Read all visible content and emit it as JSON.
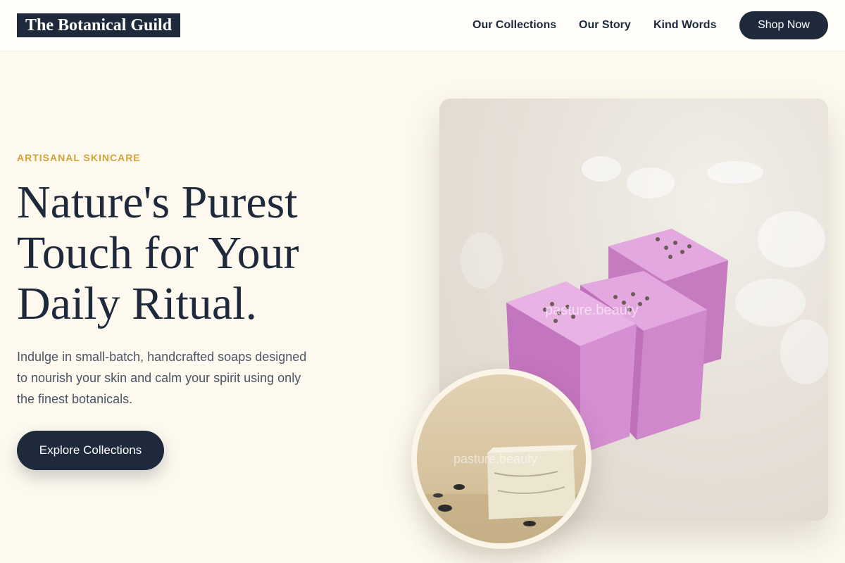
{
  "header": {
    "brand": "The Botanical Guild",
    "nav": {
      "collections": "Our Collections",
      "story": "Our Story",
      "kind_words": "Kind Words"
    },
    "cta": "Shop Now"
  },
  "hero": {
    "eyebrow": "ARTISANAL SKINCARE",
    "headline": [
      "Nature's Purest",
      "Touch for Your",
      "Daily Ritual."
    ],
    "subcopy": [
      "Indulge in small-batch, handcrafted soaps designed",
      "to nourish your skin and calm your spirit using only",
      "the finest botanicals."
    ],
    "cta": "Explore Collections",
    "main_image_watermark": "pasture.beauty",
    "inset_image_watermark": "pasture.beauty"
  },
  "colors": {
    "background": "#fdf9ee",
    "navy": "#1e293b",
    "accent_gold": "#d4a23a",
    "soap_lavender": "#d58fd3"
  }
}
